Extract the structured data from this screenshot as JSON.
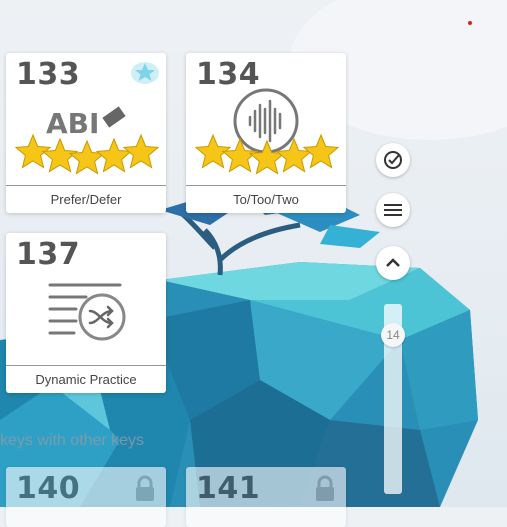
{
  "cards": [
    {
      "number": "133",
      "label": "Prefer/Defer",
      "icon": "abc-eraser-icon",
      "stars": 5,
      "badge": "star-badge-icon",
      "abbr": "ABI"
    },
    {
      "number": "134",
      "label": "To/Too/Two",
      "icon": "soundwave-icon",
      "stars": 5
    },
    {
      "number": "137",
      "label": "Dynamic Practice",
      "icon": "shuffle-list-icon",
      "stars": 0
    },
    {
      "number": "140",
      "label": "",
      "icon": "lock-icon",
      "locked": true
    },
    {
      "number": "141",
      "label": "",
      "icon": "lock-icon",
      "locked": true
    }
  ],
  "section_label": "keys with other keys",
  "slider": {
    "value": "14"
  },
  "colors": {
    "star": "#f5c518",
    "accent": "#2f5c8a",
    "icon_gray": "#777777"
  }
}
